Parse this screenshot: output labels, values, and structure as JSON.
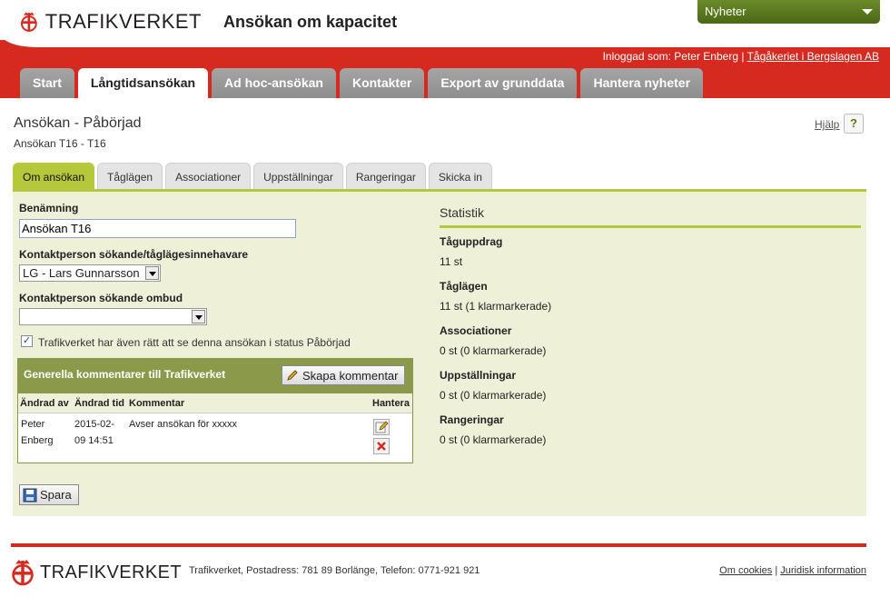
{
  "header": {
    "brand": "TRAFIKVERKET",
    "app_title": "Ansökan om kapacitet",
    "news_label": "Nyheter",
    "login_prefix": "Inloggad som: Peter Enberg |",
    "login_company": "Tågåkeriet i Bergslagen AB",
    "tabs": [
      {
        "label": "Start"
      },
      {
        "label": "Långtidsansökan"
      },
      {
        "label": "Ad hoc-ansökan"
      },
      {
        "label": "Kontakter"
      },
      {
        "label": "Export av grunddata"
      },
      {
        "label": "Hantera nyheter"
      }
    ]
  },
  "page": {
    "title": "Ansökan - Påbörjad",
    "subtitle": "Ansökan T16 - T16",
    "help_label": "Hjälp",
    "help_button": "?",
    "tabs": [
      {
        "label": "Om ansökan"
      },
      {
        "label": "Tåglägen"
      },
      {
        "label": "Associationer"
      },
      {
        "label": "Uppställningar"
      },
      {
        "label": "Rangeringar"
      },
      {
        "label": "Skicka in"
      }
    ]
  },
  "form": {
    "name_label": "Benämning",
    "name_value": "Ansökan T16",
    "contact_label": "Kontaktperson sökande/tåglägesinnehavare",
    "contact_value": "LG - Lars Gunnarsson",
    "agent_label": "Kontaktperson sökande ombud",
    "agent_value": "",
    "checkbox_label": "Trafikverket har även rätt att se denna ansökan i status Påbörjad",
    "checkbox_mark": "✓",
    "save_label": "Spara"
  },
  "comments": {
    "title": "Generella kommentarer till Trafikverket",
    "create_label": "Skapa kommentar",
    "columns": [
      "Ändrad av",
      "Ändrad tid",
      "Kommentar",
      "Hantera"
    ],
    "rows": [
      {
        "changed_by_1": "Peter",
        "changed_by_2": "Enberg",
        "changed_time_1": "2015-02-",
        "changed_time_2": "09 14:51",
        "comment": "Avser ansökan för xxxxx"
      }
    ]
  },
  "stats": {
    "title": "Statistik",
    "items": [
      {
        "label": "Tåguppdrag",
        "value": "11 st"
      },
      {
        "label": "Tåglägen",
        "value": "11 st (1 klarmarkerade)"
      },
      {
        "label": "Associationer",
        "value": "0 st (0 klarmarkerade)"
      },
      {
        "label": "Uppställningar",
        "value": "0 st (0 klarmarkerade)"
      },
      {
        "label": "Rangeringar",
        "value": "0 st (0 klarmarkerade)"
      }
    ]
  },
  "footer": {
    "brand": "TRAFIKVERKET",
    "address": "Trafikverket, Postadress: 781 89 Borlänge, Telefon: 0771-921 921",
    "cookies_label": "Om cookies",
    "separator": "|",
    "legal_label": "Juridisk information"
  },
  "colors": {
    "brand_red": "#d6291f",
    "accent_green": "#b5c73a",
    "panel_bg": "#eef0d8"
  }
}
